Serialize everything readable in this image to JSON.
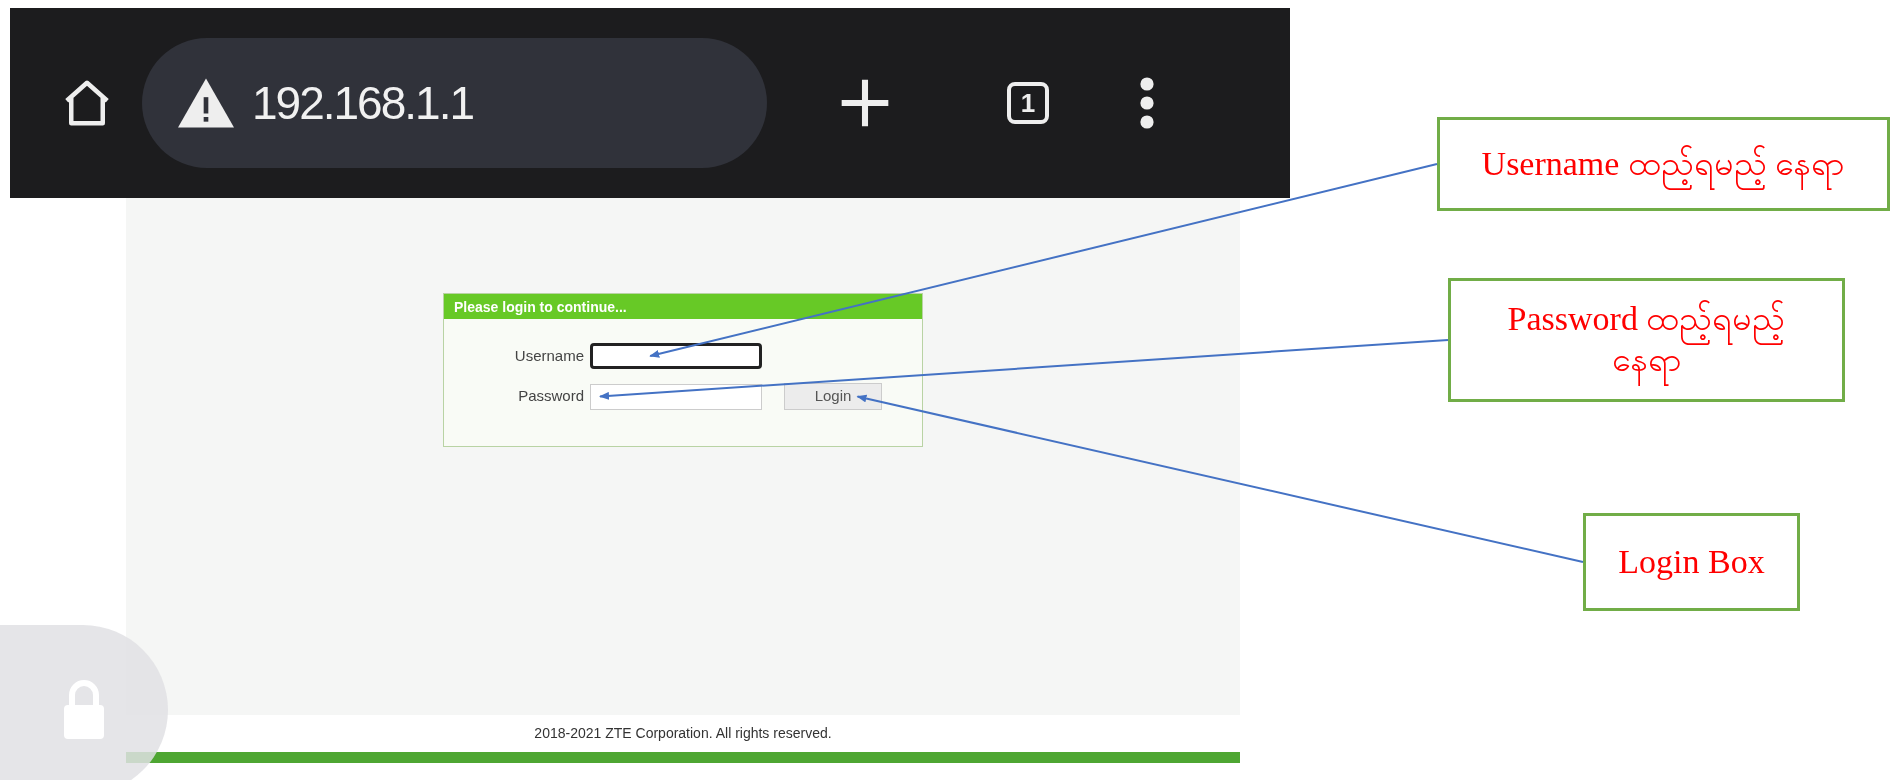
{
  "browser": {
    "url": "192.168.1.1",
    "tab_count": "1"
  },
  "login": {
    "title": "Please login to continue...",
    "fields": [
      {
        "label": "Username",
        "focused": true
      },
      {
        "label": "Password",
        "focused": false
      }
    ],
    "button": "Login"
  },
  "footer": "2018-2021 ZTE Corporation. All rights reserved.",
  "annotations": [
    {
      "text": "Username ထည့်ရမည့် နေရာ"
    },
    {
      "text": "Password ထည့်ရမည့်နေရာ"
    },
    {
      "text": "Login Box"
    }
  ]
}
